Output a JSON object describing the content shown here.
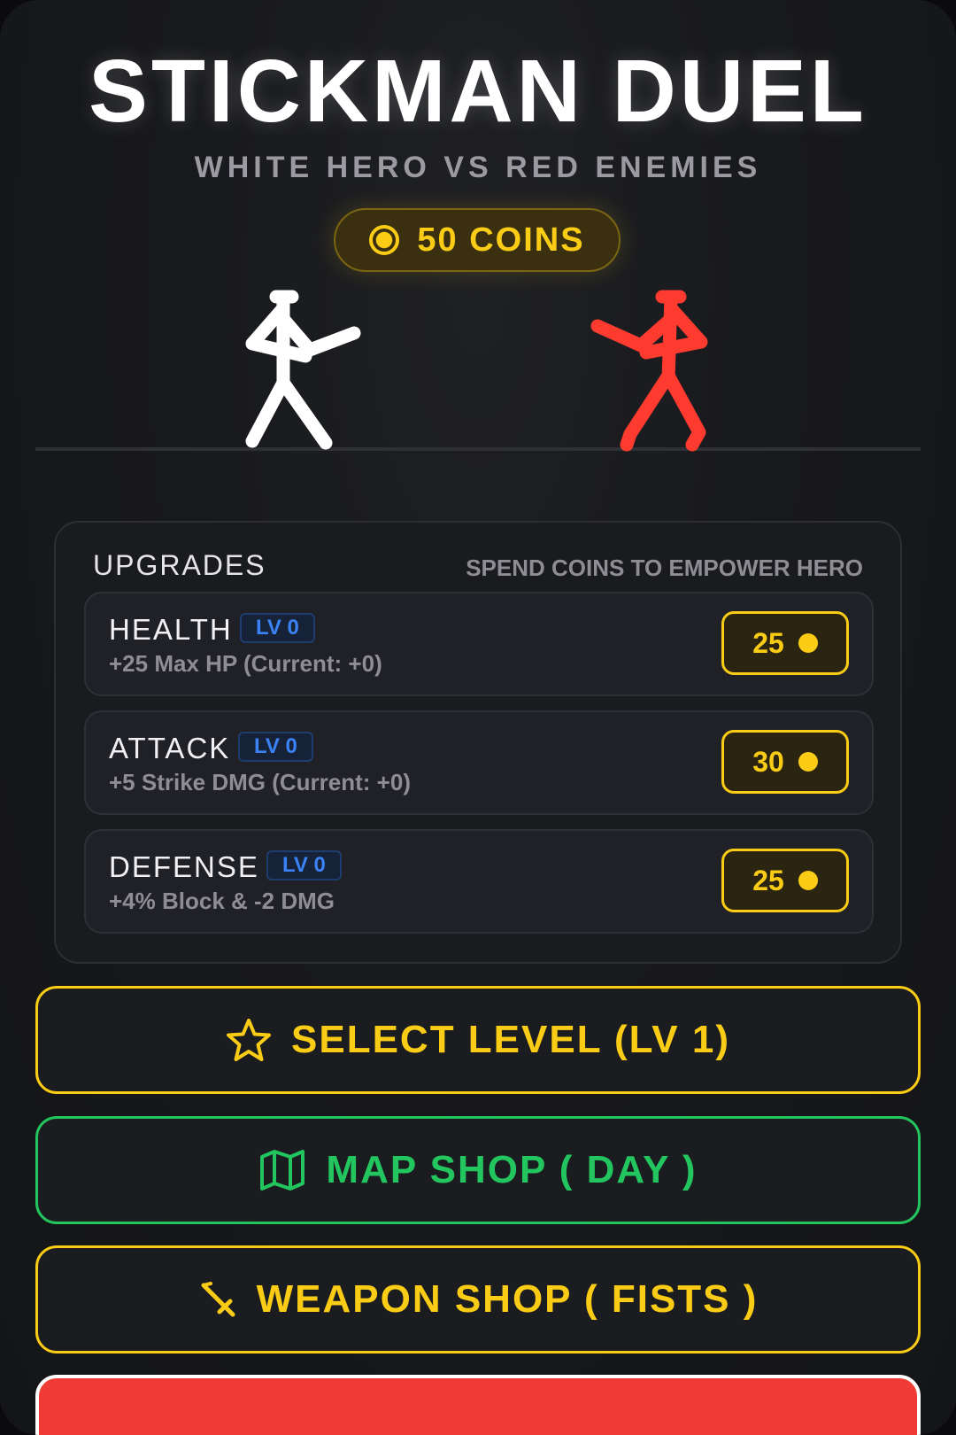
{
  "header": {
    "title": "STICKMAN DUEL",
    "subtitle": "WHITE HERO VS RED ENEMIES"
  },
  "coins": {
    "label": "50 COINS",
    "icon": "coin-icon"
  },
  "arena": {
    "hero_color": "#ffffff",
    "enemy_color": "#ff3b30"
  },
  "upgrades": {
    "title": "UPGRADES",
    "hint": "SPEND COINS TO EMPOWER HERO",
    "items": [
      {
        "name": "HEALTH",
        "level": "LV 0",
        "desc": "+25 Max HP (Current: +0)",
        "cost": "25"
      },
      {
        "name": "ATTACK",
        "level": "LV 0",
        "desc": "+5 Strike DMG (Current: +0)",
        "cost": "30"
      },
      {
        "name": "DEFENSE",
        "level": "LV 0",
        "desc": "+4% Block & -2 DMG",
        "cost": "25"
      }
    ]
  },
  "menu": {
    "select_level": "SELECT LEVEL (LV 1)",
    "map_shop": "MAP SHOP (  DAY  )",
    "weapon_shop": "WEAPON SHOP (  FISTS  )"
  },
  "colors": {
    "accent_yellow": "#facc15",
    "accent_green": "#22c55e",
    "accent_blue": "#3b82f6",
    "accent_red": "#ef3b35"
  }
}
